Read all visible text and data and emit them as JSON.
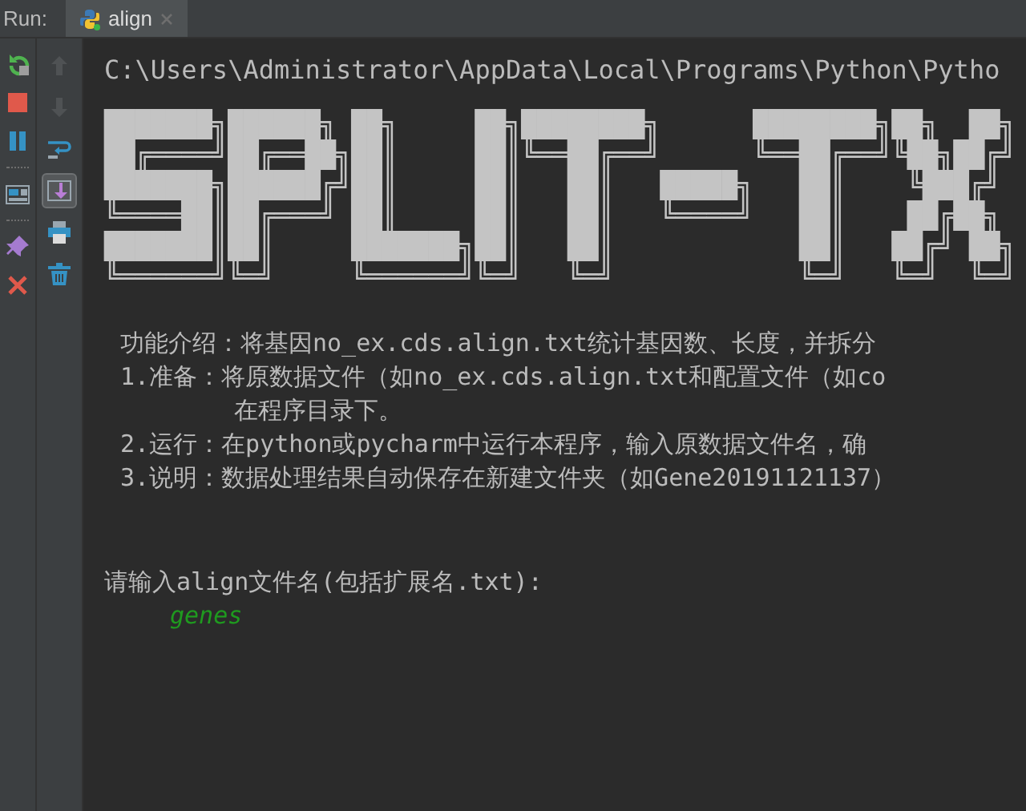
{
  "run_label": "Run:",
  "tabs": [
    {
      "label": "align",
      "selected": true
    }
  ],
  "left_tools": [
    {
      "kind": "rerun"
    },
    {
      "kind": "stop"
    },
    {
      "kind": "pause"
    },
    {
      "kind": "divider"
    },
    {
      "kind": "layout"
    },
    {
      "kind": "divider"
    },
    {
      "kind": "pin"
    },
    {
      "kind": "close"
    }
  ],
  "right_tools": [
    {
      "kind": "up",
      "disabled": true,
      "on": false
    },
    {
      "kind": "down",
      "disabled": true,
      "on": false
    },
    {
      "kind": "wrap",
      "disabled": false,
      "on": false
    },
    {
      "kind": "scroll-end",
      "disabled": false,
      "on": true
    },
    {
      "kind": "print",
      "disabled": false,
      "on": false
    },
    {
      "kind": "trash",
      "disabled": false,
      "on": false
    }
  ],
  "console": {
    "path": "C:\\Users\\Administrator\\AppData\\Local\\Programs\\Python\\Pytho",
    "banner": [
      "███████╗██████╗ ██╗     ██╗████████╗      ████████╗██╗  ██╗",
      "██╔════╝██╔══██╗██║     ██║╚══██╔══╝      ╚══██╔══╝╚██╗██╔╝",
      "███████╗██████╔╝██║     ██║   ██║   █████╗   ██║    ╚███╔╝",
      "╚════██║██╔═══╝ ██║     ██║   ██║   ╚════╝   ██║    ██╔██╗",
      "███████║██║     ███████╗██║   ██║            ██║   ██╔╝ ██╗",
      "╚══════╝╚═╝     ╚══════╝╚═╝   ╚═╝            ╚═╝   ╚═╝  ╚═╝"
    ],
    "lines": [
      {
        "kind": "info",
        "text": "功能介绍：将基因no_ex.cds.align.txt统计基因数、长度，并拆分"
      },
      {
        "kind": "info",
        "text": "1.准备：将原数据文件（如no_ex.cds.align.txt和配置文件（如co"
      },
      {
        "kind": "continuation",
        "text": "在程序目录下。"
      },
      {
        "kind": "info",
        "text": "2.运行：在python或pycharm中运行本程序，输入原数据文件名，确"
      },
      {
        "kind": "info",
        "text": "3.说明：数据处理结果自动保存在新建文件夹（如Gene20191121137）"
      }
    ],
    "prompt": "请输入align文件名(包括扩展名.txt):",
    "input": "genes"
  }
}
